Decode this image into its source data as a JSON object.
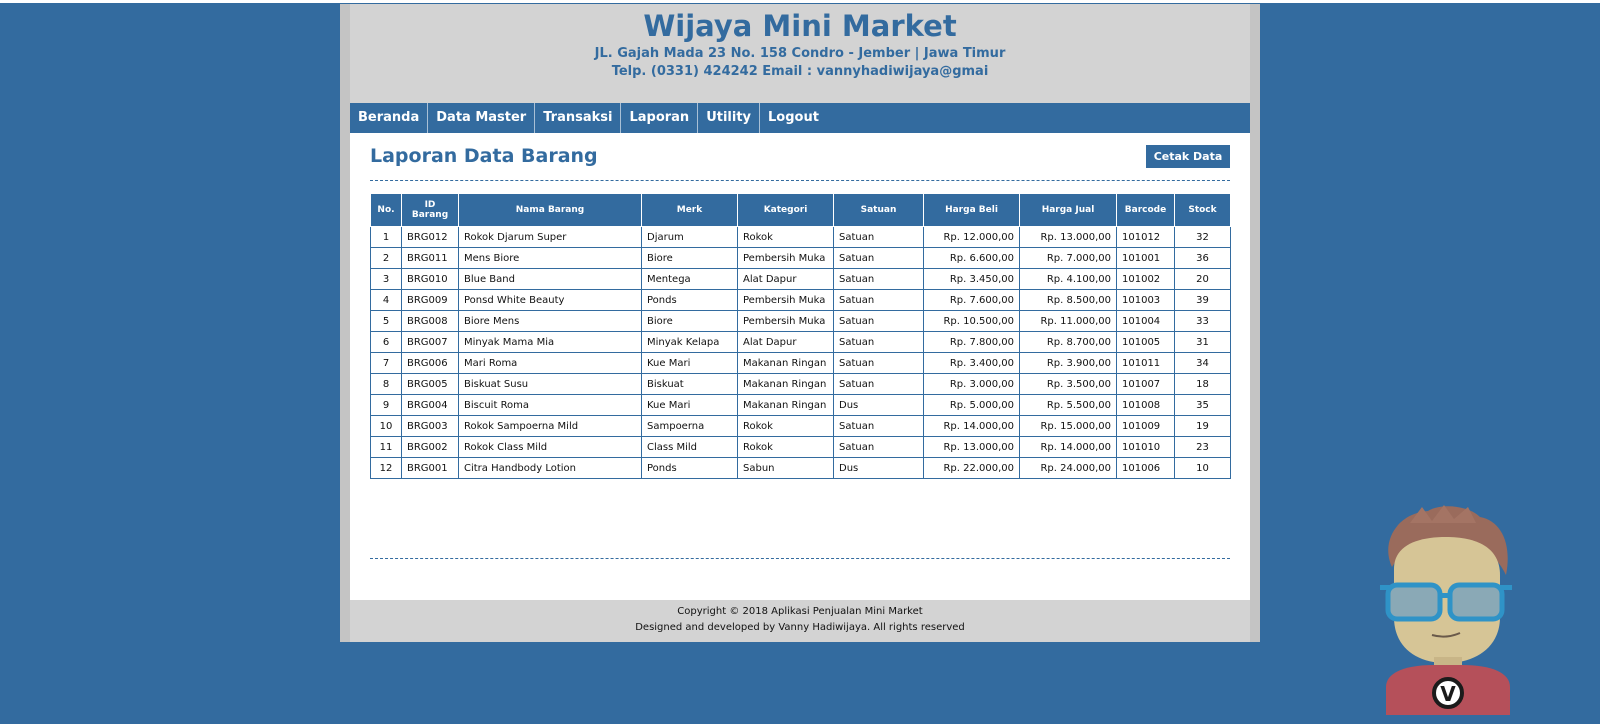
{
  "header": {
    "title": "Wijaya Mini Market",
    "address": "JL. Gajah Mada 23 No. 158 Condro - Jember | Jawa Timur",
    "contact": "Telp. (0331) 424242 Email : vannyhadiwijaya@gmai"
  },
  "nav": [
    "Beranda",
    "Data Master",
    "Transaksi",
    "Laporan",
    "Utility",
    "Logout"
  ],
  "page": {
    "title": "Laporan Data Barang",
    "print_button": "Cetak Data"
  },
  "table": {
    "headers": [
      "No.",
      "ID Barang",
      "Nama Barang",
      "Merk",
      "Kategori",
      "Satuan",
      "Harga Beli",
      "Harga Jual",
      "Barcode",
      "Stock"
    ],
    "rows": [
      [
        "1",
        "BRG012",
        "Rokok Djarum Super",
        "Djarum",
        "Rokok",
        "Satuan",
        "Rp. 12.000,00",
        "Rp. 13.000,00",
        "101012",
        "32"
      ],
      [
        "2",
        "BRG011",
        "Mens Biore",
        "Biore",
        "Pembersih Muka",
        "Satuan",
        "Rp. 6.600,00",
        "Rp. 7.000,00",
        "101001",
        "36"
      ],
      [
        "3",
        "BRG010",
        "Blue Band",
        "Mentega",
        "Alat Dapur",
        "Satuan",
        "Rp. 3.450,00",
        "Rp. 4.100,00",
        "101002",
        "20"
      ],
      [
        "4",
        "BRG009",
        "Ponsd White Beauty",
        "Ponds",
        "Pembersih Muka",
        "Satuan",
        "Rp. 7.600,00",
        "Rp. 8.500,00",
        "101003",
        "39"
      ],
      [
        "5",
        "BRG008",
        "Biore Mens",
        "Biore",
        "Pembersih Muka",
        "Satuan",
        "Rp. 10.500,00",
        "Rp. 11.000,00",
        "101004",
        "33"
      ],
      [
        "6",
        "BRG007",
        "Minyak Mama Mia",
        "Minyak Kelapa",
        "Alat Dapur",
        "Satuan",
        "Rp. 7.800,00",
        "Rp. 8.700,00",
        "101005",
        "31"
      ],
      [
        "7",
        "BRG006",
        "Mari Roma",
        "Kue Mari",
        "Makanan Ringan",
        "Satuan",
        "Rp. 3.400,00",
        "Rp. 3.900,00",
        "101011",
        "34"
      ],
      [
        "8",
        "BRG005",
        "Biskuat Susu",
        "Biskuat",
        "Makanan Ringan",
        "Satuan",
        "Rp. 3.000,00",
        "Rp. 3.500,00",
        "101007",
        "18"
      ],
      [
        "9",
        "BRG004",
        "Biscuit Roma",
        "Kue Mari",
        "Makanan Ringan",
        "Dus",
        "Rp. 5.000,00",
        "Rp. 5.500,00",
        "101008",
        "35"
      ],
      [
        "10",
        "BRG003",
        "Rokok Sampoerna Mild",
        "Sampoerna",
        "Rokok",
        "Satuan",
        "Rp. 14.000,00",
        "Rp. 15.000,00",
        "101009",
        "19"
      ],
      [
        "11",
        "BRG002",
        "Rokok Class Mild",
        "Class Mild",
        "Rokok",
        "Satuan",
        "Rp. 13.000,00",
        "Rp. 14.000,00",
        "101010",
        "23"
      ],
      [
        "12",
        "BRG001",
        "Citra Handbody Lotion",
        "Ponds",
        "Sabun",
        "Dus",
        "Rp. 22.000,00",
        "Rp. 24.000,00",
        "101006",
        "10"
      ]
    ]
  },
  "footer": {
    "copyright": "Copyright © 2018 Aplikasi Penjualan Mini Market",
    "credits": "Designed and developed by Vanny Hadiwijaya. All rights reserved"
  },
  "mascot": {
    "shirt_letter": "V"
  },
  "colors": {
    "background": "#336b9f",
    "header_bg": "#d3d3d3",
    "accent": "#336b9f"
  }
}
